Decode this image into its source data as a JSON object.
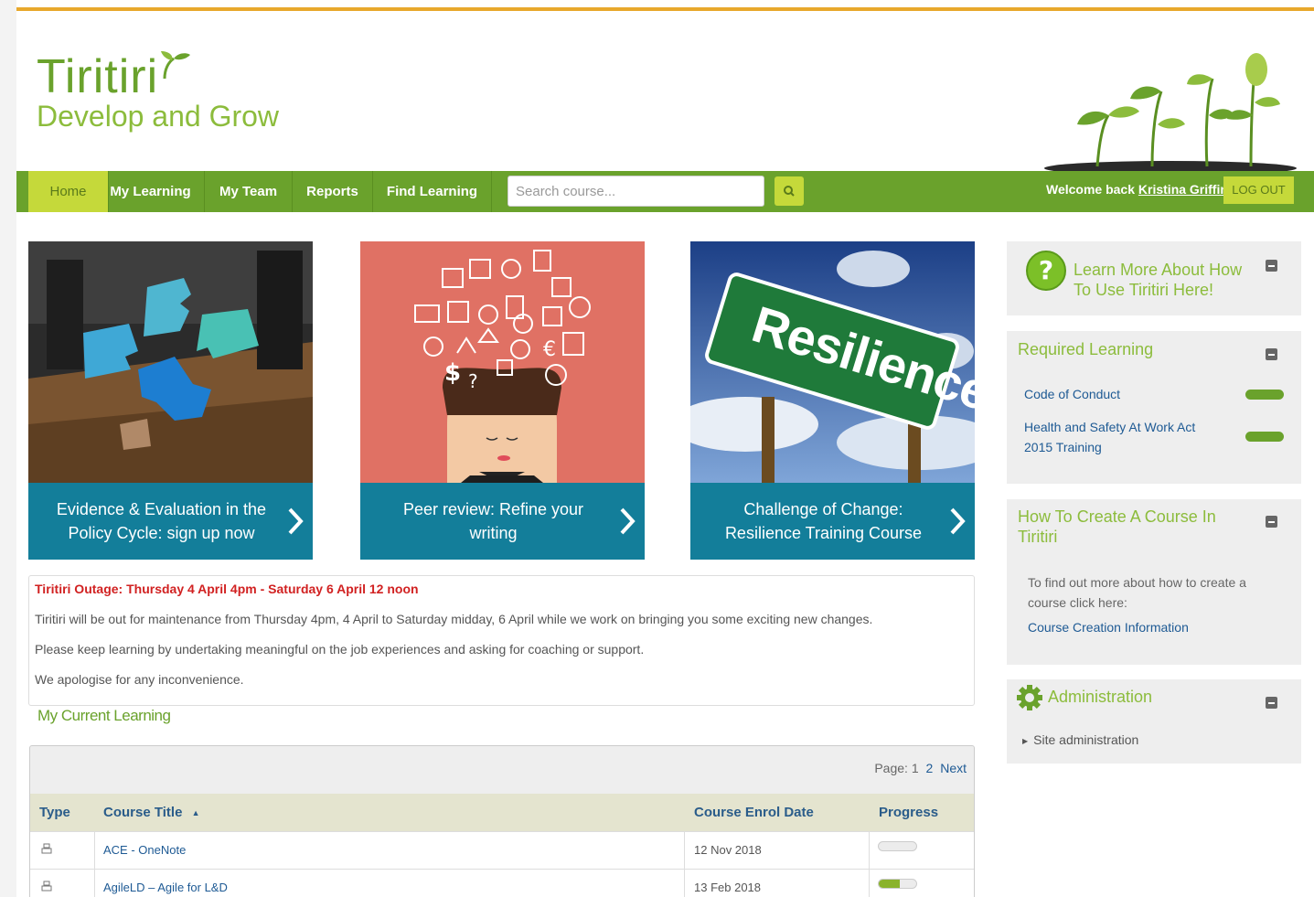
{
  "header": {
    "logo_title": "Tiritiri",
    "logo_subtitle": "Develop and Grow"
  },
  "nav": {
    "items": [
      {
        "label": "Home",
        "active": true
      },
      {
        "label": "My Learning"
      },
      {
        "label": "My Team"
      },
      {
        "label": "Reports"
      },
      {
        "label": "Find Learning"
      }
    ],
    "search_placeholder": "Search course...",
    "welcome_prefix": "Welcome back",
    "user_name": "Kristina Griffin",
    "logout_label": "LOG OUT"
  },
  "tiles": [
    {
      "caption": "Evidence & Evaluation in the Policy Cycle: sign up now",
      "image": "puzzle-pieces"
    },
    {
      "caption": "Peer review: Refine your writing",
      "image": "head-with-icons"
    },
    {
      "caption": "Challenge of Change: Resilience Training Course",
      "image": "resilience-sign",
      "sign_text": "Resilience"
    }
  ],
  "notice": {
    "title": "Tiritiri Outage: Thursday 4 April 4pm - Saturday 6 April 12 noon",
    "lines": [
      "Tiritiri will be out for maintenance from Thursday 4pm, 4 April to Saturday midday, 6 April while we work on bringing you some exciting new changes.",
      "Please keep learning by undertaking meaningful on the job experiences and asking for coaching or support.",
      "We apologise for any inconvenience."
    ]
  },
  "current_learning": {
    "title": "My Current Learning",
    "pager": {
      "label": "Page:",
      "current": "1",
      "next_page": "2",
      "next_label": "Next"
    },
    "columns": {
      "type": "Type",
      "title": "Course Title",
      "enrol": "Course Enrol Date",
      "progress": "Progress"
    },
    "sort_indicator": "▲",
    "rows": [
      {
        "type_icon": "course-icon",
        "title": "ACE - OneNote",
        "enrol_date": "12 Nov 2018",
        "progress": 0
      },
      {
        "type_icon": "course-icon",
        "title": "AgileLD – Agile for L&D",
        "enrol_date": "13 Feb 2018",
        "progress": 0.55
      }
    ]
  },
  "sidebar": {
    "help": {
      "title": "Learn More About How To Use Tiritiri Here!"
    },
    "required": {
      "title": "Required Learning",
      "items": [
        {
          "label": "Code of Conduct",
          "progress": 1
        },
        {
          "label": "Health and Safety At Work Act 2015 Training",
          "progress": 1
        }
      ]
    },
    "howto": {
      "title": "How To Create A Course In Tiritiri",
      "text": "To find out more about how to create a course click here:",
      "link": "Course Creation Information"
    },
    "admin": {
      "title": "Administration",
      "item": "Site administration"
    }
  },
  "colors": {
    "brand_green": "#6aa22c",
    "accent_lime": "#c5d93a",
    "teal": "#137e9a",
    "alert_red": "#d12121",
    "top_rule": "#e8a82c"
  }
}
